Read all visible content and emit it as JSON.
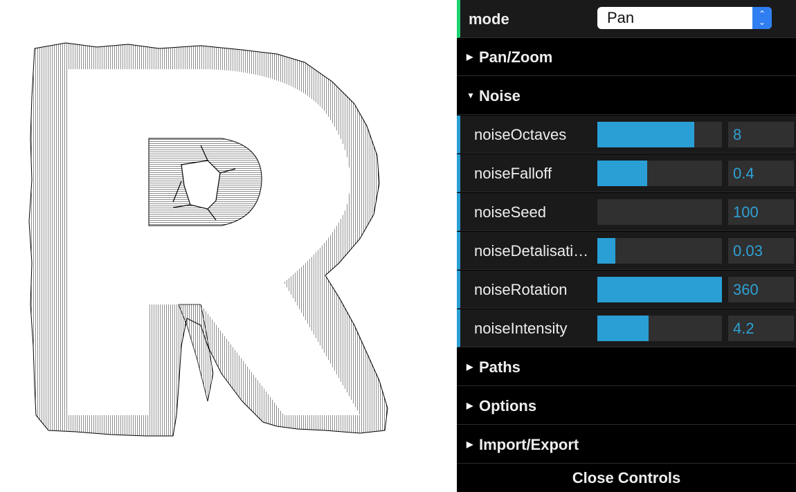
{
  "gui": {
    "mode": {
      "label": "mode",
      "value": "Pan"
    },
    "folders": {
      "pan_zoom": "Pan/Zoom",
      "noise": "Noise",
      "paths": "Paths",
      "options": "Options",
      "import_export": "Import/Export"
    },
    "params": [
      {
        "label": "noiseOctaves",
        "value": "8",
        "fill_fraction": 0.78
      },
      {
        "label": "noiseFalloff",
        "value": "0.4",
        "fill_fraction": 0.4
      },
      {
        "label": "noiseSeed",
        "value": "100",
        "fill_fraction": 0.0
      },
      {
        "label": "noiseDetalisati…",
        "value": "0.03",
        "fill_fraction": 0.14
      },
      {
        "label": "noiseRotation",
        "value": "360",
        "fill_fraction": 1.0
      },
      {
        "label": "noiseIntensity",
        "value": "4.2",
        "fill_fraction": 0.41
      }
    ],
    "close_label": "Close Controls"
  },
  "colors": {
    "accent": "#2a9fd6",
    "mode_accent": "#1ed36f",
    "panel_bg": "#1a1a1a"
  },
  "icons": {
    "select_arrows": "up-down-chevron-icon",
    "folder_closed": "triangle-right-icon",
    "folder_open": "triangle-down-icon"
  }
}
